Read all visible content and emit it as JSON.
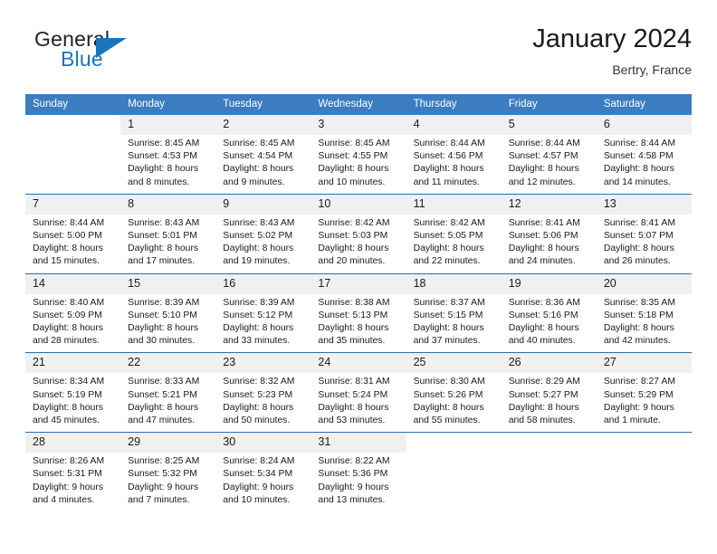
{
  "brand": {
    "name_top": "General",
    "name_bottom": "Blue",
    "triangle_icon": "brand-triangle-icon",
    "color_dark": "#231f20",
    "color_blue": "#1b75bb"
  },
  "header": {
    "title": "January 2024",
    "subtitle": "Bertry, France"
  },
  "theme": {
    "header_blue": "#3b7dc0",
    "rule_blue": "#2e6da8",
    "daynum_bg": "#f0f0f0"
  },
  "weekday_headers": [
    "Sunday",
    "Monday",
    "Tuesday",
    "Wednesday",
    "Thursday",
    "Friday",
    "Saturday"
  ],
  "weeks": [
    [
      {
        "day": "",
        "lines": []
      },
      {
        "day": "1",
        "lines": [
          "Sunrise: 8:45 AM",
          "Sunset: 4:53 PM",
          "Daylight: 8 hours",
          "and 8 minutes."
        ]
      },
      {
        "day": "2",
        "lines": [
          "Sunrise: 8:45 AM",
          "Sunset: 4:54 PM",
          "Daylight: 8 hours",
          "and 9 minutes."
        ]
      },
      {
        "day": "3",
        "lines": [
          "Sunrise: 8:45 AM",
          "Sunset: 4:55 PM",
          "Daylight: 8 hours",
          "and 10 minutes."
        ]
      },
      {
        "day": "4",
        "lines": [
          "Sunrise: 8:44 AM",
          "Sunset: 4:56 PM",
          "Daylight: 8 hours",
          "and 11 minutes."
        ]
      },
      {
        "day": "5",
        "lines": [
          "Sunrise: 8:44 AM",
          "Sunset: 4:57 PM",
          "Daylight: 8 hours",
          "and 12 minutes."
        ]
      },
      {
        "day": "6",
        "lines": [
          "Sunrise: 8:44 AM",
          "Sunset: 4:58 PM",
          "Daylight: 8 hours",
          "and 14 minutes."
        ]
      }
    ],
    [
      {
        "day": "7",
        "lines": [
          "Sunrise: 8:44 AM",
          "Sunset: 5:00 PM",
          "Daylight: 8 hours",
          "and 15 minutes."
        ]
      },
      {
        "day": "8",
        "lines": [
          "Sunrise: 8:43 AM",
          "Sunset: 5:01 PM",
          "Daylight: 8 hours",
          "and 17 minutes."
        ]
      },
      {
        "day": "9",
        "lines": [
          "Sunrise: 8:43 AM",
          "Sunset: 5:02 PM",
          "Daylight: 8 hours",
          "and 19 minutes."
        ]
      },
      {
        "day": "10",
        "lines": [
          "Sunrise: 8:42 AM",
          "Sunset: 5:03 PM",
          "Daylight: 8 hours",
          "and 20 minutes."
        ]
      },
      {
        "day": "11",
        "lines": [
          "Sunrise: 8:42 AM",
          "Sunset: 5:05 PM",
          "Daylight: 8 hours",
          "and 22 minutes."
        ]
      },
      {
        "day": "12",
        "lines": [
          "Sunrise: 8:41 AM",
          "Sunset: 5:06 PM",
          "Daylight: 8 hours",
          "and 24 minutes."
        ]
      },
      {
        "day": "13",
        "lines": [
          "Sunrise: 8:41 AM",
          "Sunset: 5:07 PM",
          "Daylight: 8 hours",
          "and 26 minutes."
        ]
      }
    ],
    [
      {
        "day": "14",
        "lines": [
          "Sunrise: 8:40 AM",
          "Sunset: 5:09 PM",
          "Daylight: 8 hours",
          "and 28 minutes."
        ]
      },
      {
        "day": "15",
        "lines": [
          "Sunrise: 8:39 AM",
          "Sunset: 5:10 PM",
          "Daylight: 8 hours",
          "and 30 minutes."
        ]
      },
      {
        "day": "16",
        "lines": [
          "Sunrise: 8:39 AM",
          "Sunset: 5:12 PM",
          "Daylight: 8 hours",
          "and 33 minutes."
        ]
      },
      {
        "day": "17",
        "lines": [
          "Sunrise: 8:38 AM",
          "Sunset: 5:13 PM",
          "Daylight: 8 hours",
          "and 35 minutes."
        ]
      },
      {
        "day": "18",
        "lines": [
          "Sunrise: 8:37 AM",
          "Sunset: 5:15 PM",
          "Daylight: 8 hours",
          "and 37 minutes."
        ]
      },
      {
        "day": "19",
        "lines": [
          "Sunrise: 8:36 AM",
          "Sunset: 5:16 PM",
          "Daylight: 8 hours",
          "and 40 minutes."
        ]
      },
      {
        "day": "20",
        "lines": [
          "Sunrise: 8:35 AM",
          "Sunset: 5:18 PM",
          "Daylight: 8 hours",
          "and 42 minutes."
        ]
      }
    ],
    [
      {
        "day": "21",
        "lines": [
          "Sunrise: 8:34 AM",
          "Sunset: 5:19 PM",
          "Daylight: 8 hours",
          "and 45 minutes."
        ]
      },
      {
        "day": "22",
        "lines": [
          "Sunrise: 8:33 AM",
          "Sunset: 5:21 PM",
          "Daylight: 8 hours",
          "and 47 minutes."
        ]
      },
      {
        "day": "23",
        "lines": [
          "Sunrise: 8:32 AM",
          "Sunset: 5:23 PM",
          "Daylight: 8 hours",
          "and 50 minutes."
        ]
      },
      {
        "day": "24",
        "lines": [
          "Sunrise: 8:31 AM",
          "Sunset: 5:24 PM",
          "Daylight: 8 hours",
          "and 53 minutes."
        ]
      },
      {
        "day": "25",
        "lines": [
          "Sunrise: 8:30 AM",
          "Sunset: 5:26 PM",
          "Daylight: 8 hours",
          "and 55 minutes."
        ]
      },
      {
        "day": "26",
        "lines": [
          "Sunrise: 8:29 AM",
          "Sunset: 5:27 PM",
          "Daylight: 8 hours",
          "and 58 minutes."
        ]
      },
      {
        "day": "27",
        "lines": [
          "Sunrise: 8:27 AM",
          "Sunset: 5:29 PM",
          "Daylight: 9 hours",
          "and 1 minute."
        ]
      }
    ],
    [
      {
        "day": "28",
        "lines": [
          "Sunrise: 8:26 AM",
          "Sunset: 5:31 PM",
          "Daylight: 9 hours",
          "and 4 minutes."
        ]
      },
      {
        "day": "29",
        "lines": [
          "Sunrise: 8:25 AM",
          "Sunset: 5:32 PM",
          "Daylight: 9 hours",
          "and 7 minutes."
        ]
      },
      {
        "day": "30",
        "lines": [
          "Sunrise: 8:24 AM",
          "Sunset: 5:34 PM",
          "Daylight: 9 hours",
          "and 10 minutes."
        ]
      },
      {
        "day": "31",
        "lines": [
          "Sunrise: 8:22 AM",
          "Sunset: 5:36 PM",
          "Daylight: 9 hours",
          "and 13 minutes."
        ]
      },
      {
        "day": "",
        "lines": []
      },
      {
        "day": "",
        "lines": []
      },
      {
        "day": "",
        "lines": []
      }
    ]
  ]
}
